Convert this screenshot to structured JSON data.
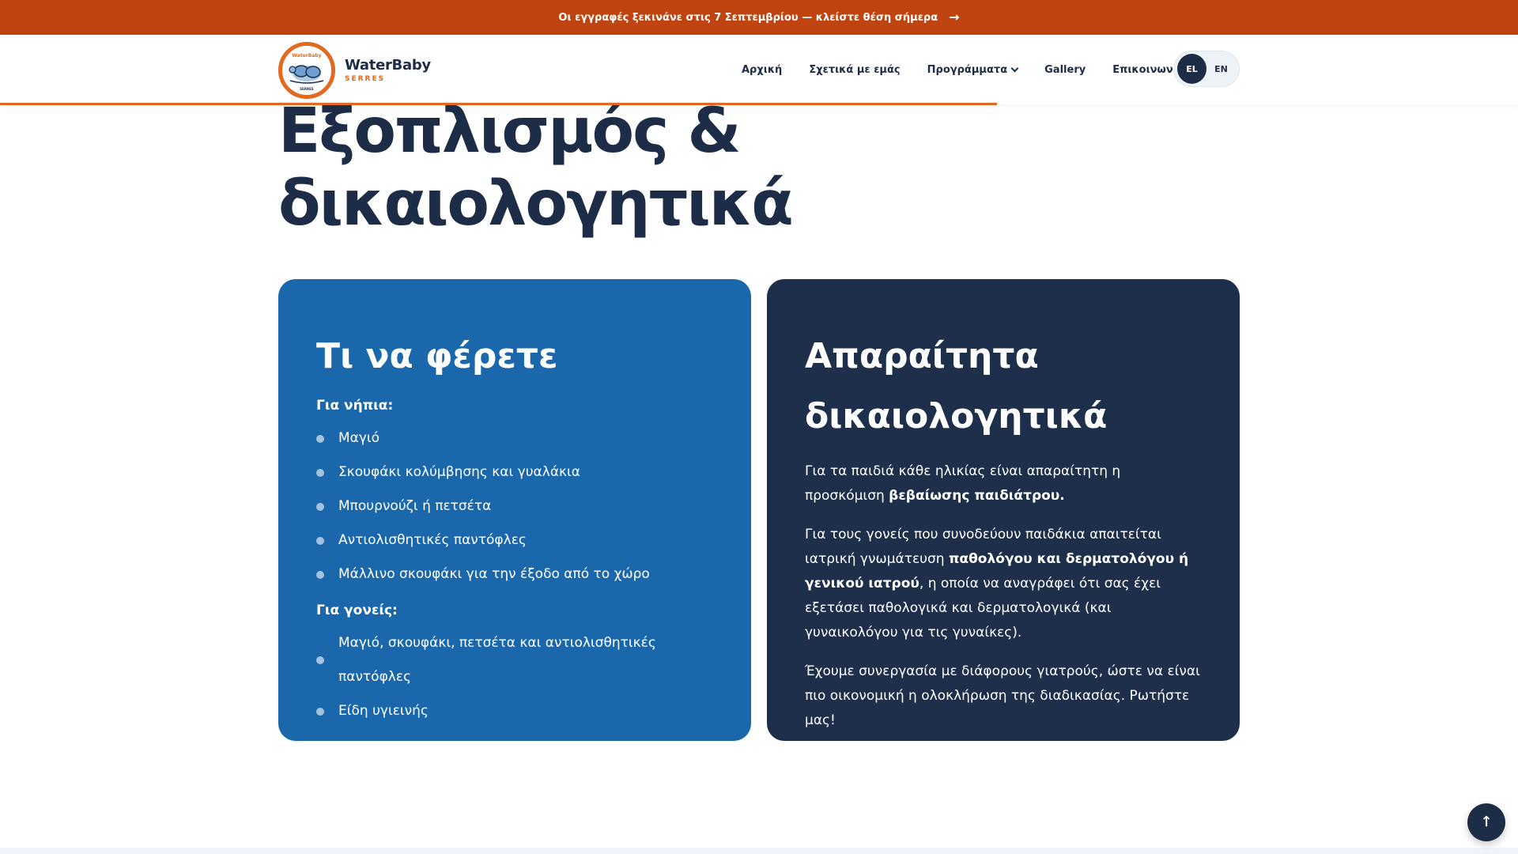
{
  "announcement": {
    "text": "Οι εγγραφές ξεκινάνε στις 7 Σεπτεμβρίου — κλείστε θέση σήμερα",
    "arrow": "→"
  },
  "brand": {
    "name": "WaterBaby",
    "sub": "SERRES",
    "badge_top": "WaterBaby",
    "badge_bottom": "SERRES"
  },
  "nav": {
    "items": [
      "Αρχική",
      "Σχετικά με εμάς",
      "Προγράμματα",
      "Gallery",
      "Επικοινωνία"
    ]
  },
  "lang": {
    "el": "EL",
    "en": "EN"
  },
  "page": {
    "title_line1": "Εξοπλισμός &",
    "title_line2": "δικαιολογητικά"
  },
  "bring": {
    "title": "Τι να φέρετε",
    "infants_heading": "Για νήπια:",
    "infants": [
      "Μαγιό",
      "Σκουφάκι κολύμβησης και γυαλάκια",
      "Μπουρνούζι ή πετσέτα",
      "Αντιολισθητικές παντόφλες",
      "Μάλλινο σκουφάκι για την έξοδο από το χώρο"
    ],
    "parents_heading": "Για γονείς:",
    "parents": [
      "Μαγιό, σκουφάκι, πετσέτα και αντιολισθητικές παντόφλες",
      "Είδη υγιεινής"
    ]
  },
  "docs": {
    "title_line1": "Απαραίτητα",
    "title_line2": "δικαιολογητικά",
    "p1_a": "Για τα παιδιά κάθε ηλικίας είναι απαραίτητη η προσκόμιση ",
    "p1_b": "βεβαίωσης παιδιάτρου.",
    "p2_a": "Για τους γονείς που συνοδεύουν παιδάκια απαιτείται ιατρική γνωμάτευση ",
    "p2_b": "παθολόγου και δερματολόγου ή γενικού ιατρού",
    "p2_c": ", η οποία να αναγράφει ότι σας έχει εξετάσει παθολογικά και δερματολογικά (και γυναικολόγου για τις γυναίκες).",
    "p3": "Έχουμε συνεργασία με διάφορους γιατρούς, ώστε να είναι πιο οικονομική η ολοκλήρωση της διαδικασίας. Ρωτήστε μας!"
  },
  "back_to_top": {
    "icon": "↑"
  },
  "colors": {
    "announce": "#c0440f",
    "accent": "#e2691f",
    "navy": "#1e2d47",
    "blue": "#1a67ac"
  }
}
